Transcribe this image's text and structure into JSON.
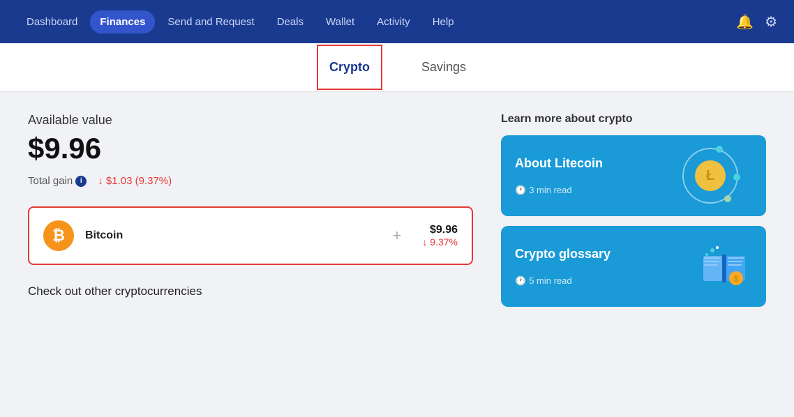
{
  "navbar": {
    "items": [
      {
        "label": "Dashboard",
        "active": false
      },
      {
        "label": "Finances",
        "active": true
      },
      {
        "label": "Send and Request",
        "active": false
      },
      {
        "label": "Deals",
        "active": false
      },
      {
        "label": "Wallet",
        "active": false
      },
      {
        "label": "Activity",
        "active": false
      },
      {
        "label": "Help",
        "active": false
      }
    ],
    "bell_icon": "🔔",
    "gear_icon": "⚙"
  },
  "tabs": [
    {
      "label": "Crypto",
      "active": true
    },
    {
      "label": "Savings",
      "active": false
    }
  ],
  "main": {
    "available_value_label": "Available value",
    "available_value_amount": "$9.96",
    "total_gain_label": "Total gain",
    "total_gain_value": "↓ $1.03 (9.37%)",
    "crypto_card": {
      "name": "Bitcoin",
      "amount": "$9.96",
      "change": "↓ 9.37%"
    },
    "check_other_label": "Check out other cryptocurrencies"
  },
  "sidebar": {
    "learn_label": "Learn more about crypto",
    "cards": [
      {
        "title": "About Litecoin",
        "time_label": "3 min read"
      },
      {
        "title": "Crypto glossary",
        "time_label": "5 min read"
      }
    ]
  },
  "icons": {
    "info": "i",
    "clock": "🕐",
    "bitcoin_symbol": "₿",
    "litecoin_symbol": "Ł"
  }
}
